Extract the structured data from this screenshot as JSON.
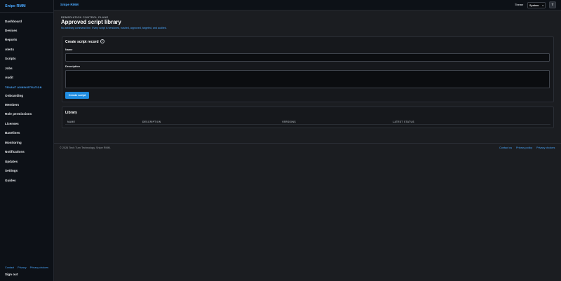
{
  "sidebar": {
    "brand": "Snipe RMM",
    "items": [
      {
        "label": "Dashboard"
      },
      {
        "label": "Devices"
      },
      {
        "label": "Reports"
      },
      {
        "label": "Alerts"
      },
      {
        "label": "Scripts"
      },
      {
        "label": "Jobs"
      },
      {
        "label": "Audit"
      }
    ],
    "section_title": "TENANT ADMINISTRATION",
    "admin_items": [
      {
        "label": "Onboarding"
      },
      {
        "label": "Members"
      },
      {
        "label": "Role permissions"
      },
      {
        "label": "Licenses"
      },
      {
        "label": "Baselines"
      },
      {
        "label": "Monitoring"
      },
      {
        "label": "Notifications"
      },
      {
        "label": "Updates"
      },
      {
        "label": "Settings"
      },
      {
        "label": "Guides"
      }
    ],
    "footer_links": [
      "Contact",
      "Privacy",
      "Privacy choices"
    ],
    "sign_out": "Sign out"
  },
  "topbar": {
    "brand": "Snipe RMM",
    "theme_label": "Theme",
    "theme_value": "System",
    "avatar_initial": "T"
  },
  "page": {
    "eyebrow": "REMEDIATION CONTROL PLANE",
    "title": "Approved script library",
    "subtitle": "No arbitrary command line. Every script is versioned, hashed, approved, targeted, and audited."
  },
  "create_card": {
    "title": "Create script record",
    "info_icon_glyph": "i",
    "name_label": "Name",
    "name_value": "",
    "description_label": "Description",
    "description_value": "",
    "button_label": "Create script"
  },
  "library": {
    "title": "Library",
    "columns": [
      "NAME",
      "DESCRIPTION",
      "VERSIONS",
      "LATEST STATUS"
    ],
    "rows": []
  },
  "footer": {
    "copyright": "© 2026 Tech Turn Technology. Snipe RMM.",
    "links": [
      "Contact us",
      "Privacy policy",
      "Privacy choices"
    ]
  },
  "colors": {
    "accent": "#4aa8ff",
    "button": "#1f8ce0",
    "background": "#1b1d21",
    "sidebar": "#0d1117"
  }
}
